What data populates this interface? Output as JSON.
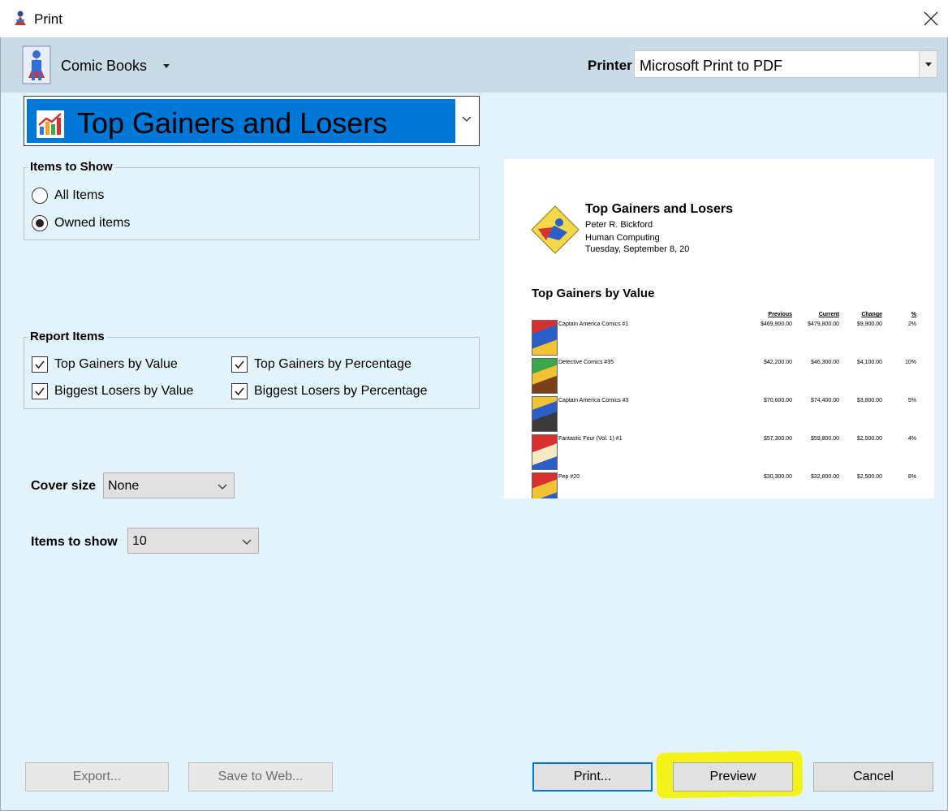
{
  "window": {
    "title": "Print"
  },
  "collection": {
    "name": "Comic Books"
  },
  "printer": {
    "label": "Printer",
    "value": "Microsoft Print to PDF"
  },
  "report": {
    "selected": "Top Gainers and Losers"
  },
  "items_to_show_group": {
    "title": "Items to Show",
    "options": [
      {
        "label": "All Items",
        "selected": false
      },
      {
        "label": "Owned items",
        "selected": true
      }
    ]
  },
  "report_items_group": {
    "title": "Report Items",
    "items": [
      {
        "label": "Top Gainers by Value",
        "checked": true
      },
      {
        "label": "Top Gainers by Percentage",
        "checked": true
      },
      {
        "label": "Biggest Losers by Value",
        "checked": true
      },
      {
        "label": "Biggest Losers by Percentage",
        "checked": true
      }
    ]
  },
  "cover_size": {
    "label": "Cover size",
    "value": "None"
  },
  "items_to_show_count": {
    "label": "Items to show",
    "value": "10"
  },
  "preview": {
    "title": "Top Gainers and Losers",
    "author": "Peter R. Bickford",
    "company": "Human Computing",
    "date": "Tuesday, September 8, 20",
    "section": "Top Gainers by Value",
    "headers": {
      "previous": "Previous",
      "current": "Current",
      "change": "Change",
      "pct": "%"
    },
    "rows": [
      {
        "name": "Captain America Comics #1",
        "previous": "$469,900.00",
        "current": "$479,800.00",
        "change": "$9,900.00",
        "pct": "2%"
      },
      {
        "name": "Detective Comics #35",
        "previous": "$42,200.00",
        "current": "$46,300.00",
        "change": "$4,100.00",
        "pct": "10%"
      },
      {
        "name": "Captain America Comics #3",
        "previous": "$70,600.00",
        "current": "$74,400.00",
        "change": "$3,800.00",
        "pct": "5%"
      },
      {
        "name": "Fantastic Four (Vol. 1) #1",
        "previous": "$57,300.00",
        "current": "$59,800.00",
        "change": "$2,500.00",
        "pct": "4%"
      },
      {
        "name": "Pep #20",
        "previous": "$30,300.00",
        "current": "$32,800.00",
        "change": "$2,500.00",
        "pct": "8%"
      }
    ]
  },
  "buttons": {
    "export": "Export...",
    "save_web": "Save to Web...",
    "print": "Print...",
    "preview": "Preview",
    "cancel": "Cancel"
  },
  "colors": {
    "dialog_bg": "#e3f3fb",
    "header_bg": "#c9dbe6",
    "selection_blue": "#0078d7",
    "highlight_yellow": "#f3f31a"
  }
}
